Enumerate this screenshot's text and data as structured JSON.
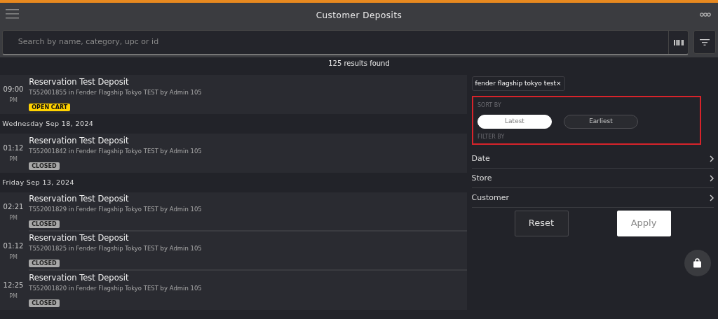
{
  "header": {
    "title": "Customer Deposits"
  },
  "search": {
    "placeholder": "Search by name, category, upc or id"
  },
  "results": "125 results found",
  "groups": [
    {
      "items": [
        {
          "hour": "09:00",
          "ampm": "PM",
          "title": "Reservation Test Deposit",
          "detail": "T552001855 in Fender Flagship Tokyo TEST by Admin 105",
          "status": "OPEN CART",
          "kind": "open"
        }
      ]
    },
    {
      "date": "Wednesday Sep 18, 2024",
      "items": [
        {
          "hour": "01:12",
          "ampm": "PM",
          "title": "Reservation Test Deposit",
          "detail": "T552001842 in Fender Flagship Tokyo TEST by Admin 105",
          "status": "CLOSED",
          "kind": "closed"
        }
      ]
    },
    {
      "date": "Friday Sep 13, 2024",
      "items": [
        {
          "hour": "02:21",
          "ampm": "PM",
          "title": "Reservation Test Deposit",
          "detail": "T552001829 in Fender Flagship Tokyo TEST by Admin 105",
          "status": "CLOSED",
          "kind": "closed"
        },
        {
          "hour": "01:12",
          "ampm": "PM",
          "title": "Reservation Test Deposit",
          "detail": "T552001825 in Fender Flagship Tokyo TEST by Admin 105",
          "status": "CLOSED",
          "kind": "closed"
        },
        {
          "hour": "12:25",
          "ampm": "PM",
          "title": "Reservation Test Deposit",
          "detail": "T552001820 in Fender Flagship Tokyo TEST by Admin 105",
          "status": "CLOSED",
          "kind": "closed"
        }
      ]
    }
  ],
  "filters": {
    "chips": [
      {
        "label": "fender flagship tokyo test",
        "remove": "×"
      }
    ],
    "sort_label": "SORT BY",
    "sort_options": [
      {
        "label": "Latest",
        "selected": true
      },
      {
        "label": "Earliest",
        "selected": false
      }
    ],
    "filter_label": "FILTER BY",
    "filter_items": [
      "Date",
      "Store",
      "Customer"
    ],
    "reset": "Reset",
    "apply": "Apply"
  }
}
